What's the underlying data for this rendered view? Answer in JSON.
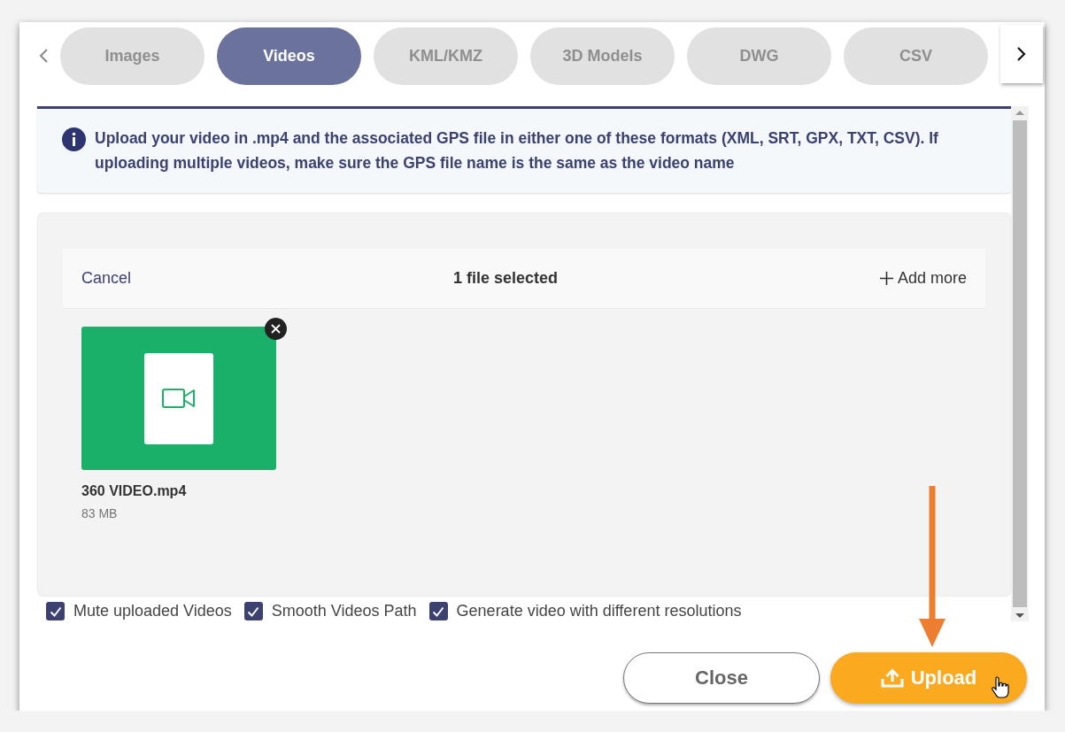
{
  "tabs": [
    {
      "label": "Images",
      "selected": false
    },
    {
      "label": "Videos",
      "selected": true
    },
    {
      "label": "KML/KMZ",
      "selected": false
    },
    {
      "label": "3D Models",
      "selected": false
    },
    {
      "label": "DWG",
      "selected": false
    },
    {
      "label": "CSV",
      "selected": false
    }
  ],
  "info": "Upload your video in .mp4 and the associated GPS file in either one of these formats (XML, SRT, GPX, TXT, CSV). If uploading multiple videos, make sure the GPS file name is the same as the video name",
  "uploader": {
    "cancel": "Cancel",
    "status": "1 file selected",
    "add_more": "Add more",
    "files": [
      {
        "name": "360 VIDEO.mp4",
        "size": "83 MB"
      }
    ]
  },
  "options": [
    {
      "label": "Mute uploaded Videos",
      "checked": true
    },
    {
      "label": "Smooth Videos Path",
      "checked": true
    },
    {
      "label": "Generate video with different resolutions",
      "checked": true
    }
  ],
  "buttons": [
    {
      "label": "Close",
      "kind": "secondary"
    },
    {
      "label": "Upload",
      "kind": "primary"
    }
  ]
}
